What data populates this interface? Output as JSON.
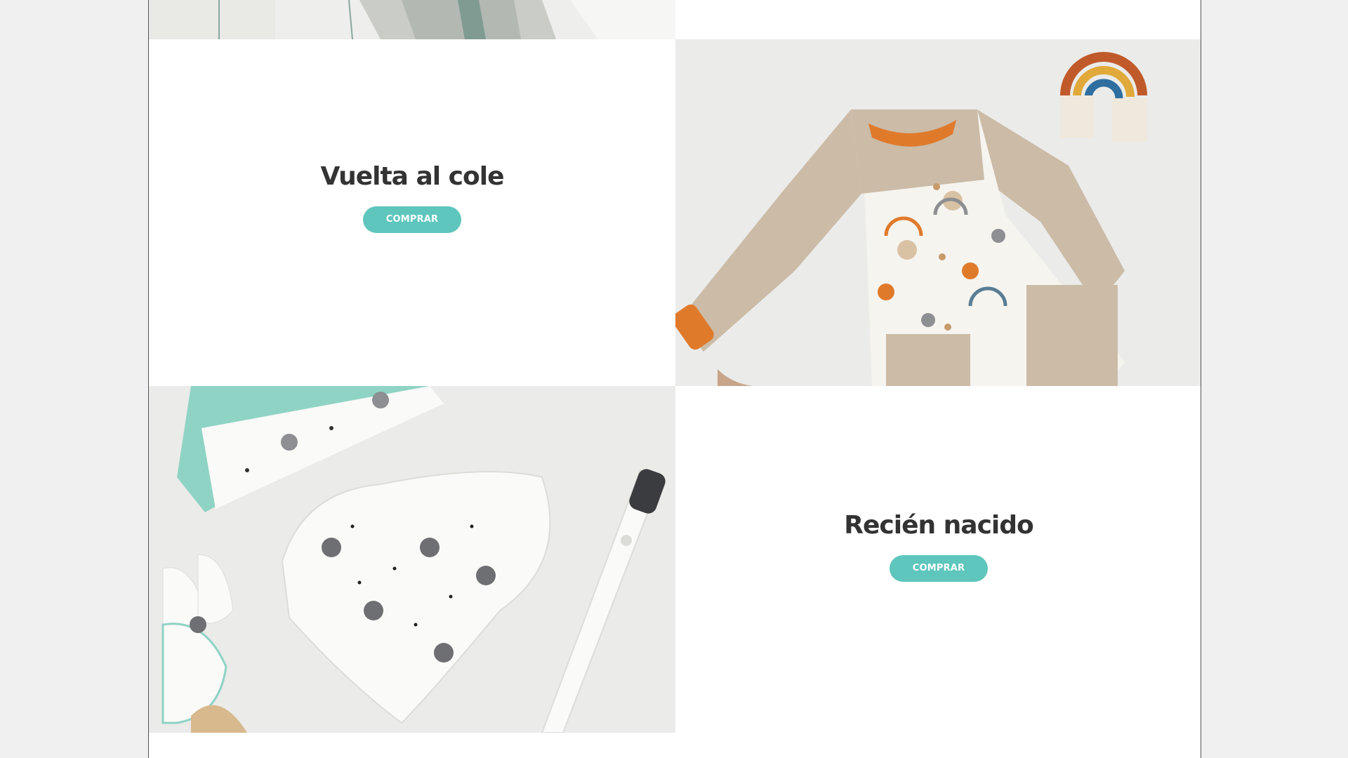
{
  "colors": {
    "accent": "#5ec6bd",
    "heading": "#333333",
    "frame_background": "#f0f0f0"
  },
  "sections": [
    {
      "title": "Vuelta al cole",
      "button_label": "COMPRAR"
    },
    {
      "title": "Recién nacido",
      "button_label": "COMPRAR"
    }
  ]
}
